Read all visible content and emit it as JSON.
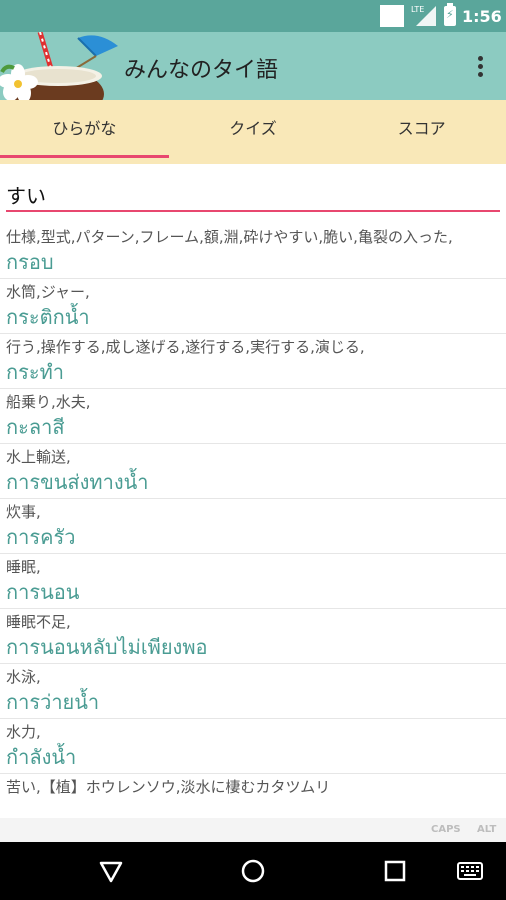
{
  "status_bar": {
    "network": "LTE",
    "time": "1:56"
  },
  "app_bar": {
    "title": "みんなのタイ語"
  },
  "tabs": [
    {
      "label": "ひらがな",
      "active": true
    },
    {
      "label": "クイズ",
      "active": false
    },
    {
      "label": "スコア",
      "active": false
    }
  ],
  "search": {
    "value": "すい"
  },
  "entries": [
    {
      "meaning": "仕様,型式,パターン,フレーム,額,淵,砕けやすい,脆い,亀裂の入った,",
      "thai": "กรอบ"
    },
    {
      "meaning": "水筒,ジャー,",
      "thai": "กระติกน้ำ"
    },
    {
      "meaning": "行う,操作する,成し遂げる,遂行する,実行する,演じる,",
      "thai": "กระทำ"
    },
    {
      "meaning": "船乗り,水夫,",
      "thai": "กะลาสี"
    },
    {
      "meaning": "水上輸送,",
      "thai": "การขนส่งทางน้ำ"
    },
    {
      "meaning": "炊事,",
      "thai": "การครัว"
    },
    {
      "meaning": "睡眠,",
      "thai": "การนอน"
    },
    {
      "meaning": "睡眠不足,",
      "thai": "การนอนหลับไม่เพียงพอ"
    },
    {
      "meaning": "水泳,",
      "thai": "การว่ายน้ำ"
    },
    {
      "meaning": "水力,",
      "thai": "กำลังน้ำ"
    },
    {
      "meaning": "苦い,【植】ホウレンソウ,淡水に棲むカタツムリ",
      "thai": ""
    }
  ],
  "keyboard_strip": {
    "caps": "CAPS",
    "alt": "ALT"
  },
  "colors": {
    "status_bar": "#5aa69b",
    "app_bar": "#8ccbc1",
    "tab_bar": "#f9e8b8",
    "accent": "#e8476f",
    "thai_text": "#4a9c93"
  },
  "icons": {
    "logo": "coconut-drink-icon",
    "menu": "overflow-menu-icon",
    "back": "back-triangle-icon",
    "home": "home-circle-icon",
    "recents": "recents-square-icon",
    "keyboard": "keyboard-icon"
  }
}
